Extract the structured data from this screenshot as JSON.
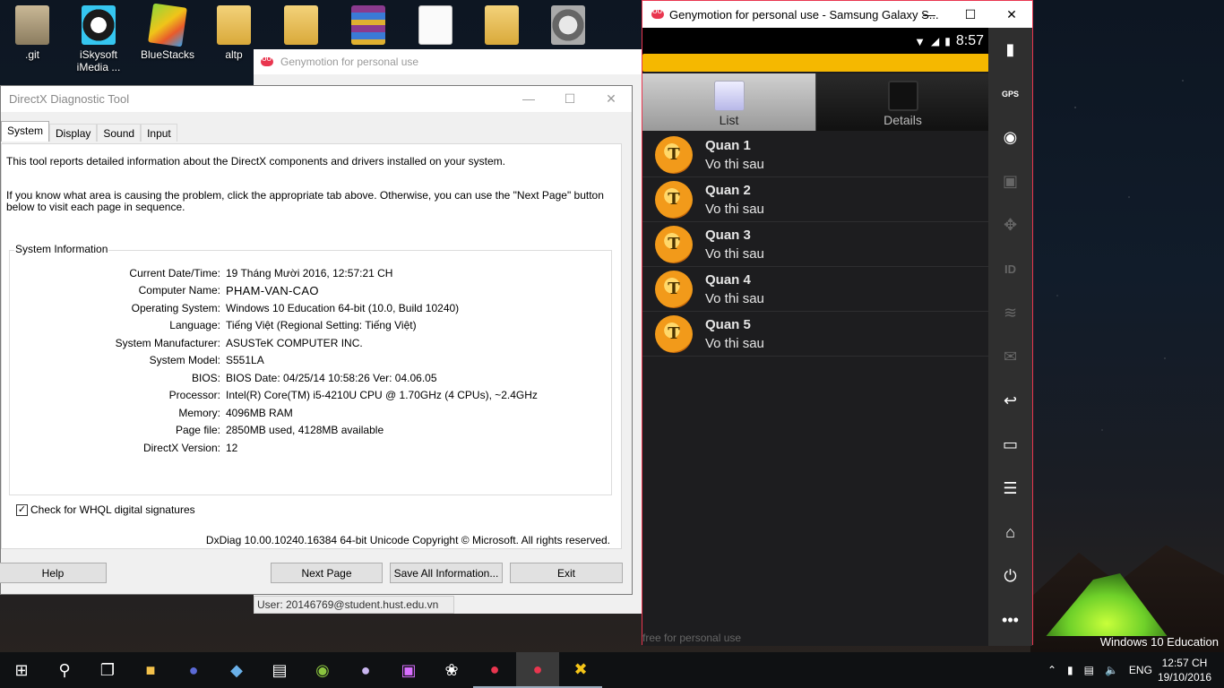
{
  "desktop": {
    "icons": [
      {
        "label": ".git"
      },
      {
        "label": "iSkysoft iMedia ..."
      },
      {
        "label": "BlueStacks"
      },
      {
        "label": "altp"
      },
      {
        "label": ""
      },
      {
        "label": ""
      },
      {
        "label": ""
      },
      {
        "label": ""
      },
      {
        "label": ""
      }
    ],
    "os_watermark": "Windows 10 Education"
  },
  "genymotion_back": {
    "title": "Genymotion for personal use",
    "user": "User: 20146769@student.hust.edu.vn"
  },
  "dxdiag": {
    "title": "DirectX Diagnostic Tool",
    "tabs": [
      "System",
      "Display",
      "Sound",
      "Input"
    ],
    "intro1": "This tool reports detailed information about the DirectX components and drivers installed on your system.",
    "intro2": "If you know what area is causing the problem, click the appropriate tab above.  Otherwise, you can use the \"Next Page\" button below to visit each page in sequence.",
    "group_title": "System Information",
    "info": [
      {
        "key": "Current Date/Time:",
        "value": "19 Tháng Mười 2016, 12:57:21 CH"
      },
      {
        "key": "Computer Name:",
        "value": "PHAM-VAN-CAO"
      },
      {
        "key": "Operating System:",
        "value": "Windows 10 Education 64-bit (10.0, Build 10240)"
      },
      {
        "key": "Language:",
        "value": "Tiếng Việt (Regional Setting: Tiếng Việt)"
      },
      {
        "key": "System Manufacturer:",
        "value": "ASUSTeK COMPUTER INC."
      },
      {
        "key": "System Model:",
        "value": "S551LA"
      },
      {
        "key": "BIOS:",
        "value": "BIOS Date: 04/25/14 10:58:26 Ver: 04.06.05"
      },
      {
        "key": "Processor:",
        "value": "Intel(R) Core(TM) i5-4210U CPU @ 1.70GHz (4 CPUs), ~2.4GHz"
      },
      {
        "key": "Memory:",
        "value": "4096MB RAM"
      },
      {
        "key": "Page file:",
        "value": "2850MB used, 4128MB available"
      },
      {
        "key": "DirectX Version:",
        "value": "12"
      }
    ],
    "checkbox_label": "Check for WHQL digital signatures",
    "checkbox_checked": true,
    "copyright": "DxDiag 10.00.10240.16384 64-bit Unicode  Copyright © Microsoft. All rights reserved.",
    "buttons": {
      "help": "Help",
      "next": "Next Page",
      "save": "Save All Information...",
      "exit": "Exit"
    }
  },
  "genymotion": {
    "title": "Genymotion for personal use - Samsung Galaxy S...",
    "time": "8:57",
    "tabs": [
      {
        "label": "List"
      },
      {
        "label": "Details"
      }
    ],
    "items": [
      {
        "avatar": "T",
        "title": "Quan 1",
        "subtitle": "Vo thi sau"
      },
      {
        "avatar": "T",
        "title": "Quan 2",
        "subtitle": "Vo thi sau"
      },
      {
        "avatar": "T",
        "title": "Quan 3",
        "subtitle": "Vo thi sau"
      },
      {
        "avatar": "T",
        "title": "Quan 4",
        "subtitle": "Vo thi sau"
      },
      {
        "avatar": "T",
        "title": "Quan 5",
        "subtitle": "Vo thi sau"
      }
    ],
    "watermark": "free for personal use",
    "side_gps": "GPS",
    "side_id": "ID",
    "accent": "#e9364f"
  },
  "taskbar": {
    "lang": "ENG",
    "time": "12:57 CH",
    "date": "19/10/2016"
  }
}
